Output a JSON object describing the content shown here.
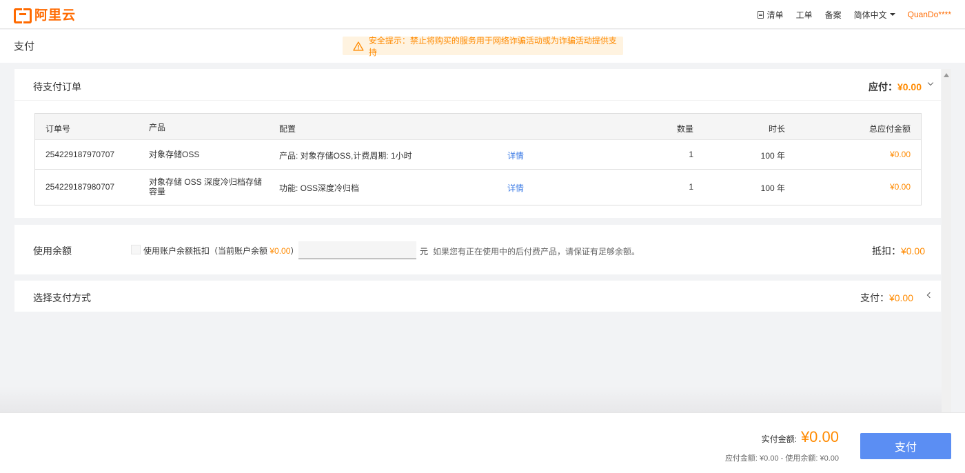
{
  "header": {
    "logo_text": "阿里云",
    "nav": {
      "cart": "清单",
      "ticket": "工单",
      "filing": "备案",
      "language": "简体中文",
      "user": "QuanDo****"
    }
  },
  "page": {
    "title": "支付",
    "notice": "安全提示：禁止将购买的服务用于网络诈骗活动或为诈骗活动提供支持"
  },
  "orders": {
    "title": "待支付订单",
    "due_label": "应付：",
    "due_amount": "¥0.00",
    "columns": {
      "order_no": "订单号",
      "product": "产品",
      "config": "配置",
      "quantity": "数量",
      "duration": "时长",
      "total": "总应付金额"
    },
    "rows": [
      {
        "order_no": "254229187970707",
        "product": "对象存储OSS",
        "config": "产品: 对象存储OSS,计费周期: 1小时",
        "detail": "详情",
        "quantity": "1",
        "duration": "100 年",
        "total": "¥0.00"
      },
      {
        "order_no": "254229187980707",
        "product": "对象存储 OSS 深度冷归档存储容量",
        "config": "功能: OSS深度冷归档",
        "detail": "详情",
        "quantity": "1",
        "duration": "100 年",
        "total": "¥0.00"
      }
    ]
  },
  "balance": {
    "title": "使用余额",
    "checkbox_label": "使用账户余额抵扣（当前账户余额",
    "current_balance": "¥0.00",
    "close_paren": "）",
    "input_value": "",
    "unit": "元",
    "hint": "如果您有正在使用中的后付费产品，请保证有足够余额。",
    "deduct_label": "抵扣：",
    "deduct_amount": "¥0.00"
  },
  "payment_method": {
    "title": "选择支付方式",
    "pay_label": "支付：",
    "pay_amount": "¥0.00"
  },
  "footer": {
    "actual_label": "实付金额:",
    "actual_amount": "¥0.00",
    "breakdown": "应付金额: ¥0.00 - 使用余额: ¥0.00",
    "pay_button": "支付"
  },
  "colors": {
    "brand": "#ff6a00",
    "amount": "#ff8a00",
    "link": "#3f7de6",
    "pay_button": "#5b8ef3",
    "notice_bg": "#fff3e0"
  }
}
